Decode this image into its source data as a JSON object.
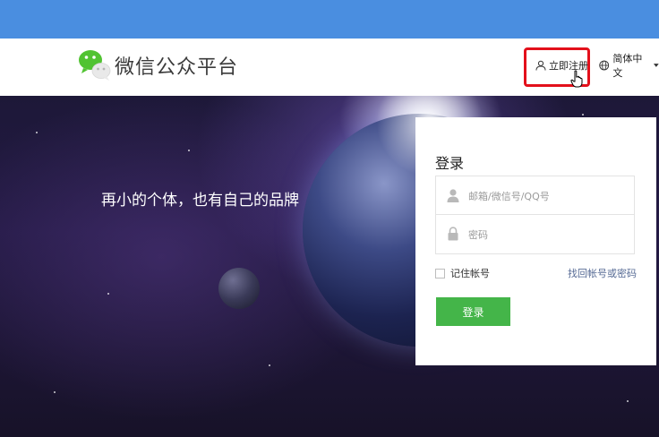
{
  "header": {
    "logo_text": "微信公众平台",
    "register_label": "立即注册",
    "language_label": "简体中文"
  },
  "banner": {
    "slogan": "再小的个体，也有自己的品牌"
  },
  "login": {
    "title": "登录",
    "account_placeholder": "邮箱/微信号/QQ号",
    "password_placeholder": "密码",
    "remember_label": "记住帐号",
    "forgot_link": "找回帐号或密码",
    "submit_label": "登录"
  },
  "colors": {
    "topbar": "#4a8ee0",
    "accent_green": "#44b549",
    "link": "#576b95",
    "highlight_red": "#e3101b"
  }
}
